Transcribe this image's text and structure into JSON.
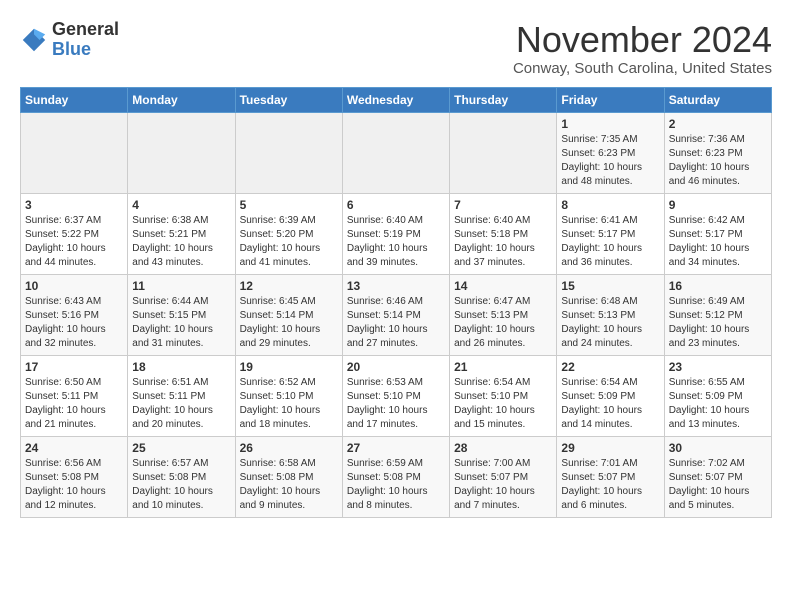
{
  "logo": {
    "general": "General",
    "blue": "Blue"
  },
  "header": {
    "month": "November 2024",
    "location": "Conway, South Carolina, United States"
  },
  "days_of_week": [
    "Sunday",
    "Monday",
    "Tuesday",
    "Wednesday",
    "Thursday",
    "Friday",
    "Saturday"
  ],
  "weeks": [
    [
      {
        "day": "",
        "info": ""
      },
      {
        "day": "",
        "info": ""
      },
      {
        "day": "",
        "info": ""
      },
      {
        "day": "",
        "info": ""
      },
      {
        "day": "",
        "info": ""
      },
      {
        "day": "1",
        "info": "Sunrise: 7:35 AM\nSunset: 6:23 PM\nDaylight: 10 hours and 48 minutes."
      },
      {
        "day": "2",
        "info": "Sunrise: 7:36 AM\nSunset: 6:23 PM\nDaylight: 10 hours and 46 minutes."
      }
    ],
    [
      {
        "day": "3",
        "info": "Sunrise: 6:37 AM\nSunset: 5:22 PM\nDaylight: 10 hours and 44 minutes."
      },
      {
        "day": "4",
        "info": "Sunrise: 6:38 AM\nSunset: 5:21 PM\nDaylight: 10 hours and 43 minutes."
      },
      {
        "day": "5",
        "info": "Sunrise: 6:39 AM\nSunset: 5:20 PM\nDaylight: 10 hours and 41 minutes."
      },
      {
        "day": "6",
        "info": "Sunrise: 6:40 AM\nSunset: 5:19 PM\nDaylight: 10 hours and 39 minutes."
      },
      {
        "day": "7",
        "info": "Sunrise: 6:40 AM\nSunset: 5:18 PM\nDaylight: 10 hours and 37 minutes."
      },
      {
        "day": "8",
        "info": "Sunrise: 6:41 AM\nSunset: 5:17 PM\nDaylight: 10 hours and 36 minutes."
      },
      {
        "day": "9",
        "info": "Sunrise: 6:42 AM\nSunset: 5:17 PM\nDaylight: 10 hours and 34 minutes."
      }
    ],
    [
      {
        "day": "10",
        "info": "Sunrise: 6:43 AM\nSunset: 5:16 PM\nDaylight: 10 hours and 32 minutes."
      },
      {
        "day": "11",
        "info": "Sunrise: 6:44 AM\nSunset: 5:15 PM\nDaylight: 10 hours and 31 minutes."
      },
      {
        "day": "12",
        "info": "Sunrise: 6:45 AM\nSunset: 5:14 PM\nDaylight: 10 hours and 29 minutes."
      },
      {
        "day": "13",
        "info": "Sunrise: 6:46 AM\nSunset: 5:14 PM\nDaylight: 10 hours and 27 minutes."
      },
      {
        "day": "14",
        "info": "Sunrise: 6:47 AM\nSunset: 5:13 PM\nDaylight: 10 hours and 26 minutes."
      },
      {
        "day": "15",
        "info": "Sunrise: 6:48 AM\nSunset: 5:13 PM\nDaylight: 10 hours and 24 minutes."
      },
      {
        "day": "16",
        "info": "Sunrise: 6:49 AM\nSunset: 5:12 PM\nDaylight: 10 hours and 23 minutes."
      }
    ],
    [
      {
        "day": "17",
        "info": "Sunrise: 6:50 AM\nSunset: 5:11 PM\nDaylight: 10 hours and 21 minutes."
      },
      {
        "day": "18",
        "info": "Sunrise: 6:51 AM\nSunset: 5:11 PM\nDaylight: 10 hours and 20 minutes."
      },
      {
        "day": "19",
        "info": "Sunrise: 6:52 AM\nSunset: 5:10 PM\nDaylight: 10 hours and 18 minutes."
      },
      {
        "day": "20",
        "info": "Sunrise: 6:53 AM\nSunset: 5:10 PM\nDaylight: 10 hours and 17 minutes."
      },
      {
        "day": "21",
        "info": "Sunrise: 6:54 AM\nSunset: 5:10 PM\nDaylight: 10 hours and 15 minutes."
      },
      {
        "day": "22",
        "info": "Sunrise: 6:54 AM\nSunset: 5:09 PM\nDaylight: 10 hours and 14 minutes."
      },
      {
        "day": "23",
        "info": "Sunrise: 6:55 AM\nSunset: 5:09 PM\nDaylight: 10 hours and 13 minutes."
      }
    ],
    [
      {
        "day": "24",
        "info": "Sunrise: 6:56 AM\nSunset: 5:08 PM\nDaylight: 10 hours and 12 minutes."
      },
      {
        "day": "25",
        "info": "Sunrise: 6:57 AM\nSunset: 5:08 PM\nDaylight: 10 hours and 10 minutes."
      },
      {
        "day": "26",
        "info": "Sunrise: 6:58 AM\nSunset: 5:08 PM\nDaylight: 10 hours and 9 minutes."
      },
      {
        "day": "27",
        "info": "Sunrise: 6:59 AM\nSunset: 5:08 PM\nDaylight: 10 hours and 8 minutes."
      },
      {
        "day": "28",
        "info": "Sunrise: 7:00 AM\nSunset: 5:07 PM\nDaylight: 10 hours and 7 minutes."
      },
      {
        "day": "29",
        "info": "Sunrise: 7:01 AM\nSunset: 5:07 PM\nDaylight: 10 hours and 6 minutes."
      },
      {
        "day": "30",
        "info": "Sunrise: 7:02 AM\nSunset: 5:07 PM\nDaylight: 10 hours and 5 minutes."
      }
    ]
  ]
}
